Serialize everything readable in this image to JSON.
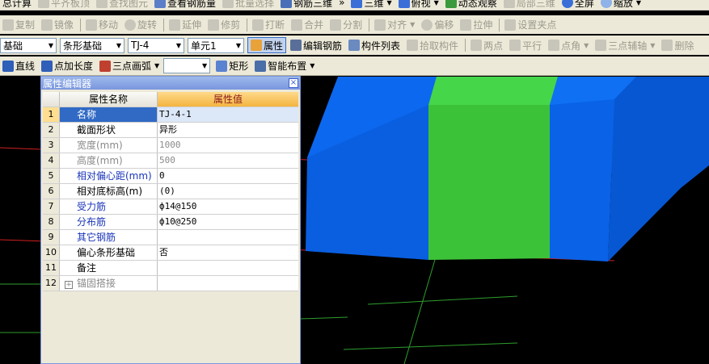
{
  "toolbar1": {
    "items": [
      {
        "label": "总计算",
        "icon": "calc-icon"
      },
      {
        "label": "平齐板顶",
        "icon": "align-top-icon"
      },
      {
        "label": "查找图元",
        "icon": "find-icon"
      },
      {
        "label": "查看钢筋量",
        "icon": "view-rebar-icon"
      },
      {
        "label": "批量选择",
        "icon": "batch-select-icon"
      },
      {
        "label": "钢筋三维",
        "icon": "rebar-3d-icon"
      },
      {
        "label": "三维",
        "icon": "3d-icon"
      },
      {
        "label": "俯视",
        "icon": "top-view-icon"
      },
      {
        "label": "动态观察",
        "icon": "orbit-icon"
      },
      {
        "label": "局部三维",
        "icon": "local-3d-icon"
      },
      {
        "label": "全屏",
        "icon": "fullscreen-icon"
      },
      {
        "label": "缩放",
        "icon": "zoom-icon"
      }
    ]
  },
  "toolbar2": {
    "items": [
      {
        "label": "复制",
        "icon": "copy-icon"
      },
      {
        "label": "镜像",
        "icon": "mirror-icon"
      },
      {
        "label": "移动",
        "icon": "move-icon"
      },
      {
        "label": "旋转",
        "icon": "rotate-icon"
      },
      {
        "label": "延伸",
        "icon": "extend-icon"
      },
      {
        "label": "修剪",
        "icon": "trim-icon"
      },
      {
        "label": "打断",
        "icon": "break-icon"
      },
      {
        "label": "合并",
        "icon": "merge-icon"
      },
      {
        "label": "分割",
        "icon": "split-icon"
      },
      {
        "label": "对齐",
        "icon": "align-icon"
      },
      {
        "label": "偏移",
        "icon": "offset-icon"
      },
      {
        "label": "拉伸",
        "icon": "stretch-icon"
      },
      {
        "label": "设置夹点",
        "icon": "grip-icon"
      }
    ]
  },
  "toolbar3": {
    "combos": [
      "基础",
      "条形基础",
      "TJ-4",
      "单元1"
    ],
    "items": [
      {
        "label": "属性",
        "icon": "property-icon"
      },
      {
        "label": "编辑钢筋",
        "icon": "edit-rebar-icon"
      },
      {
        "label": "构件列表",
        "icon": "component-list-icon"
      },
      {
        "label": "拾取构件",
        "icon": "pick-icon"
      },
      {
        "label": "两点",
        "icon": "two-point-icon"
      },
      {
        "label": "平行",
        "icon": "parallel-icon"
      },
      {
        "label": "点角",
        "icon": "point-angle-icon"
      },
      {
        "label": "三点辅轴",
        "icon": "three-point-axis-icon"
      },
      {
        "label": "删除",
        "icon": "delete-icon"
      }
    ]
  },
  "toolbar4": {
    "items": [
      {
        "label": "直线",
        "icon": "line-icon"
      },
      {
        "label": "点加长度",
        "icon": "point-length-icon"
      },
      {
        "label": "三点画弧",
        "icon": "arc-icon"
      },
      {
        "label": "矩形",
        "icon": "rectangle-icon"
      },
      {
        "label": "智能布置",
        "icon": "smart-layout-icon"
      }
    ]
  },
  "panel": {
    "title": "属性编辑器",
    "col_name": "属性名称",
    "col_value": "属性值",
    "rows": [
      {
        "no": "1",
        "name": "名称",
        "value": "TJ-4-1"
      },
      {
        "no": "2",
        "name": "截面形状",
        "value": "异形"
      },
      {
        "no": "3",
        "name": "宽度(mm)",
        "value": "1000"
      },
      {
        "no": "4",
        "name": "高度(mm)",
        "value": "500"
      },
      {
        "no": "5",
        "name": "相对偏心距(mm)",
        "value": "0"
      },
      {
        "no": "6",
        "name": "相对底标高(m)",
        "value": "(0)"
      },
      {
        "no": "7",
        "name": "受力筋",
        "value": "ф14@150"
      },
      {
        "no": "8",
        "name": "分布筋",
        "value": "ф10@250"
      },
      {
        "no": "9",
        "name": "其它钢筋",
        "value": ""
      },
      {
        "no": "10",
        "name": "偏心条形基础",
        "value": "否"
      },
      {
        "no": "11",
        "name": "备注",
        "value": ""
      },
      {
        "no": "12",
        "name": "锚固搭接",
        "value": ""
      }
    ]
  },
  "colors": {
    "block_blue": "#0a62e6",
    "block_green": "#3ec93a",
    "grid_line": "#2e9e2e",
    "axis_red": "#d02020"
  }
}
